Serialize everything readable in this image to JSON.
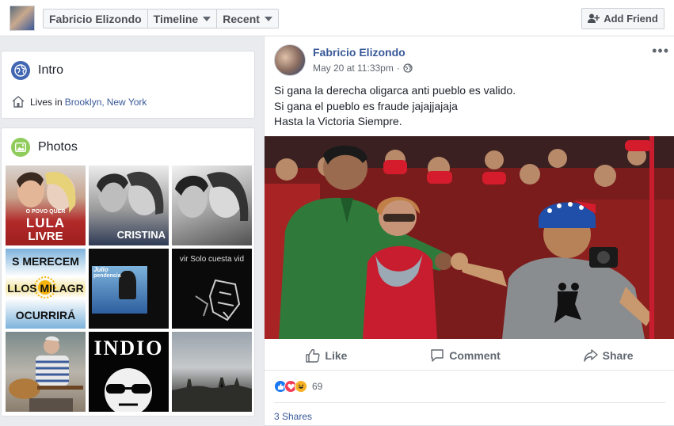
{
  "header": {
    "profile_name": "Fabricio Elizondo",
    "timeline_label": "Timeline",
    "recent_label": "Recent",
    "add_friend_label": "Add Friend"
  },
  "intro": {
    "title": "Intro",
    "lives_prefix": "Lives in",
    "city": "Brooklyn",
    "sep": ",",
    "state": "New York"
  },
  "photos": {
    "title": "Photos",
    "tiles": [
      {
        "name": "photo-1",
        "line1": "O POVO QUER",
        "line2": "LULA",
        "line3": "LIVRE"
      },
      {
        "name": "photo-2",
        "line1": "CRISTINA"
      },
      {
        "name": "photo-3"
      },
      {
        "name": "photo-4",
        "line1": "S MERECEM",
        "line2": "LLOS MILAGR",
        "line3": "OCURRIRÁ"
      },
      {
        "name": "photo-5",
        "line1": "Julio",
        "line2": "pendencia"
      },
      {
        "name": "photo-6",
        "line1": "vir Solo cuesta vid"
      },
      {
        "name": "photo-7"
      },
      {
        "name": "photo-8",
        "line1": "INDIO"
      },
      {
        "name": "photo-9"
      }
    ]
  },
  "post": {
    "author": "Fabricio Elizondo",
    "time": "May 20 at 11:33pm",
    "time_sep": "·",
    "more": "•••",
    "lines": [
      "Si gana la derecha oligarca anti pueblo es valido.",
      "Si gana el pueblo es fraude jajajjajaja",
      "Hasta la Victoria Siempre."
    ],
    "like_label": "Like",
    "comment_label": "Comment",
    "share_label": "Share",
    "reaction_count": "69",
    "shares_text": "3 Shares"
  },
  "colors": {
    "link": "#385898",
    "like_blue": "#1877f2",
    "love_red": "#f33e58",
    "haha_yellow": "#f7b125",
    "intro_icon": "#4267b2",
    "photos_icon": "#8fcc5b"
  },
  "icons": {
    "intro": "globe-icon",
    "photos": "photo-icon",
    "home": "home-icon",
    "privacy": "globe-small-icon",
    "add_friend": "person-plus-icon"
  }
}
